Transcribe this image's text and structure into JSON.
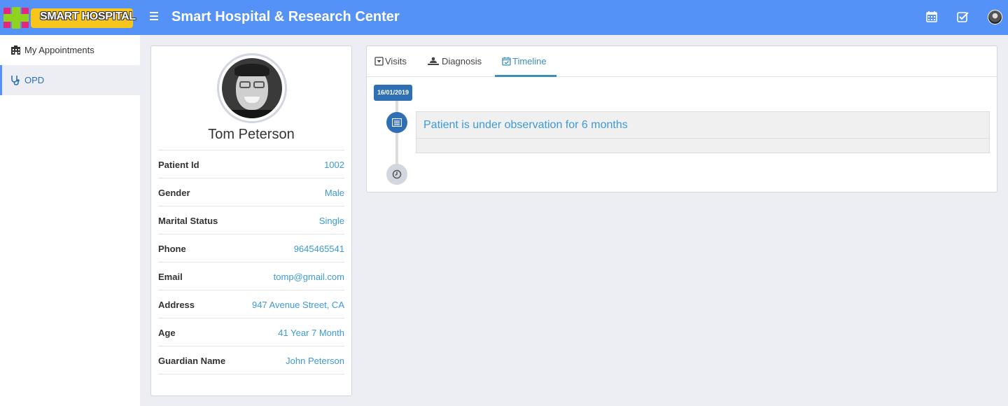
{
  "header": {
    "logo_text": "SMART HOSPITAL",
    "title": "Smart Hospital & Research Center",
    "icons": [
      "menu-icon",
      "calendar-icon",
      "task-check-icon",
      "user-avatar"
    ]
  },
  "sidebar": {
    "items": [
      {
        "label": "My Appointments",
        "icon": "hospital-building-icon",
        "active": false
      },
      {
        "label": "OPD",
        "icon": "stethoscope-icon",
        "active": true
      }
    ]
  },
  "profile": {
    "name": "Tom Peterson",
    "fields": [
      {
        "label": "Patient Id",
        "value": "1002"
      },
      {
        "label": "Gender",
        "value": "Male"
      },
      {
        "label": "Marital Status",
        "value": "Single"
      },
      {
        "label": "Phone",
        "value": "9645465541"
      },
      {
        "label": "Email",
        "value": "tomp@gmail.com"
      },
      {
        "label": "Address",
        "value": "947 Avenue Street, CA"
      },
      {
        "label": "Age",
        "value": "41 Year 7 Month"
      },
      {
        "label": "Guardian Name",
        "value": "John Peterson"
      }
    ]
  },
  "tabs": [
    {
      "label": "Visits",
      "icon": "caret-square-down-icon",
      "active": false
    },
    {
      "label": "Diagnosis",
      "icon": "diagnosis-icon",
      "active": false
    },
    {
      "label": "Timeline",
      "icon": "calendar-check-icon",
      "active": true
    }
  ],
  "timeline": {
    "date": "16/01/2019",
    "entries": [
      {
        "title": "Patient is under observation for 6 months",
        "icon": "list-alt-icon"
      }
    ],
    "end_icon": "clock-icon"
  },
  "colors": {
    "header": "#5592f7",
    "accent": "#2f6fb4",
    "link": "#3c9ad6",
    "background": "#eceef3"
  }
}
